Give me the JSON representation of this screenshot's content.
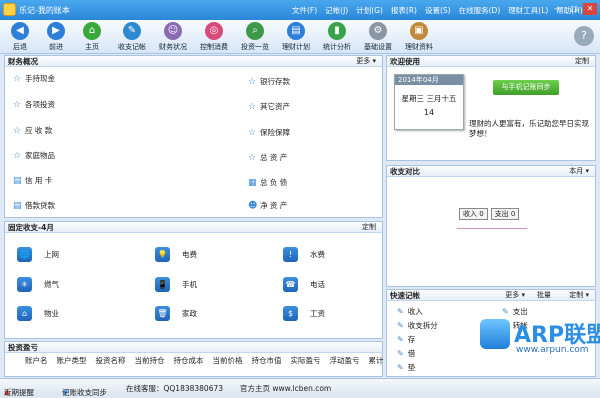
{
  "window": {
    "title": "乐记-我的账本",
    "menu": [
      "文件(F)",
      "记帐(J)",
      "计划(G)",
      "报表(R)",
      "设置(S)",
      "在线服务(D)",
      "理财工具(L)",
      "帮助(H)"
    ],
    "controls": {
      "min": "—",
      "max": "□",
      "close": "✕"
    }
  },
  "toolbar": {
    "items": [
      {
        "label": "后退",
        "icon": "◀",
        "color": "#2e7fd8"
      },
      {
        "label": "前进",
        "icon": "▶",
        "color": "#2e7fd8"
      },
      {
        "label": "主页",
        "icon": "⌂",
        "color": "#39a83a"
      },
      {
        "label": "收支记帐",
        "icon": "✎",
        "color": "#2e8ad0"
      },
      {
        "label": "财务状况",
        "icon": "☺",
        "color": "#8c6bb5"
      },
      {
        "label": "控制消费",
        "icon": "◎",
        "color": "#d84a7a"
      },
      {
        "label": "投资一览",
        "icon": "⌕",
        "color": "#3e9a4a"
      },
      {
        "label": "理财计划",
        "icon": "▤",
        "color": "#2e7fd8"
      },
      {
        "label": "统计分析",
        "icon": "▮",
        "color": "#3aa24a"
      },
      {
        "label": "基础设置",
        "icon": "⚙",
        "color": "#8a96a4"
      },
      {
        "label": "理财资料",
        "icon": "▣",
        "color": "#c08a3a"
      }
    ],
    "help": "?"
  },
  "finance": {
    "title": "财务概况",
    "more": "更多 ▾",
    "left": [
      "手持现金",
      "各项投资",
      "应 收 款",
      "家庭物品",
      "信 用 卡",
      "借款贷款"
    ],
    "right": [
      "银行存款",
      "其它资产",
      "保险保障",
      "总 资 产",
      "总 负 债",
      "净 资 产"
    ]
  },
  "welcome": {
    "title": "欢迎使用",
    "custom": "定制",
    "cal_month": "2014年04月",
    "cal_weekday": "星期三",
    "cal_lunar": "三月十五",
    "cal_day": "14",
    "sync_button": "与手机记账同步",
    "tip": "理财的人更富有，乐记助您早日实现梦想！"
  },
  "compare": {
    "title": "收支对比",
    "period": "本月 ▾",
    "income": "收入 0",
    "expense": "支出 0"
  },
  "fixed": {
    "title": "固定收支-4月",
    "custom": "定制",
    "items": [
      {
        "label": "上网",
        "icon": "🌐"
      },
      {
        "label": "电费",
        "icon": "💡"
      },
      {
        "label": "水费",
        "icon": "!"
      },
      {
        "label": "燃气",
        "icon": "✳"
      },
      {
        "label": "手机",
        "icon": "📱"
      },
      {
        "label": "电话",
        "icon": "☎"
      },
      {
        "label": "物业",
        "icon": "⌂"
      },
      {
        "label": "家政",
        "icon": "🗑"
      },
      {
        "label": "工资",
        "icon": "$"
      }
    ]
  },
  "quick": {
    "title": "快速记帐",
    "more": "更多 ▾",
    "batch": "批量",
    "custom": "定制 ▾",
    "left": [
      "收入",
      "收支拆分",
      "存",
      "借",
      "垫"
    ],
    "right": [
      "支出",
      "转帐"
    ]
  },
  "invest": {
    "title": "投资盈亏",
    "cols": [
      "账户名",
      "账户类型",
      "投资名称",
      "当前持仓",
      "持仓成本",
      "当前价格",
      "持仓市值",
      "实际盈亏",
      "浮动盈亏",
      "累计"
    ]
  },
  "status": {
    "reminder": "近期提醒",
    "sync": "记账收支同步",
    "service": "在线客服：QQ1838380673",
    "site": "官方主页 www.lcben.com"
  },
  "watermark": {
    "brand": "ARP联盟",
    "url": "www.arpun.com"
  }
}
